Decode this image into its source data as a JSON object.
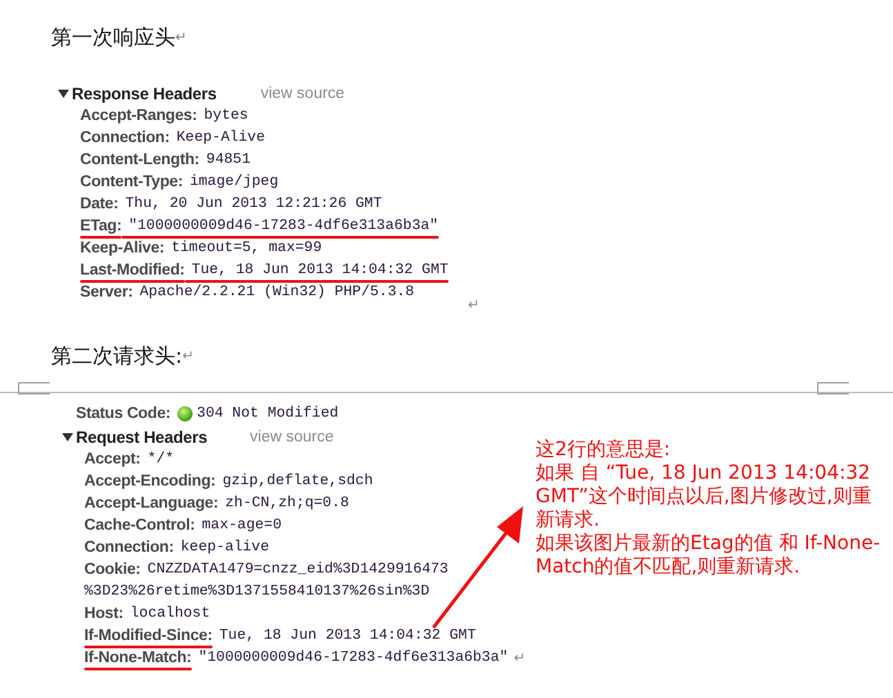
{
  "sections": [
    {
      "heading": "第一次响应头",
      "heading_mark": "↵",
      "panel": {
        "title": "Response Headers",
        "expanded": true,
        "link": "view source",
        "end_mark": "↵",
        "headers": [
          {
            "name": "Accept-Ranges:",
            "value": "bytes",
            "name_underlined": false,
            "value_underlined": false
          },
          {
            "name": "Connection:",
            "value": "Keep-Alive",
            "name_underlined": false,
            "value_underlined": false
          },
          {
            "name": "Content-Length:",
            "value": "94851",
            "name_underlined": false,
            "value_underlined": false
          },
          {
            "name": "Content-Type:",
            "value": "image/jpeg",
            "name_underlined": false,
            "value_underlined": false
          },
          {
            "name": "Date:",
            "value": "Thu, 20 Jun 2013 12:21:26 GMT",
            "name_underlined": false,
            "value_underlined": false
          },
          {
            "name": "ETag:",
            "value": "\"1000000009d46-17283-4df6e313a6b3a\"",
            "name_underlined": true,
            "value_underlined": true
          },
          {
            "name": "Keep-Alive:",
            "value": "timeout=5, max=99",
            "name_underlined": false,
            "value_underlined": false
          },
          {
            "name": "Last-Modified:",
            "value": "Tue, 18 Jun 2013 14:04:32 GMT",
            "name_underlined": true,
            "value_underlined": true
          },
          {
            "name": "Server:",
            "value": "Apache/2.2.21 (Win32) PHP/5.3.8",
            "name_underlined": false,
            "value_underlined": false
          }
        ]
      }
    },
    {
      "heading": "第二次请求头:",
      "heading_mark": "↵",
      "page_break": true,
      "status": {
        "label": "Status Code:",
        "value": "304 Not Modified"
      },
      "panel": {
        "title": "Request Headers",
        "expanded": true,
        "link": "view source",
        "headers": [
          {
            "name": "Accept:",
            "value": "*/*",
            "name_underlined": false,
            "value_underlined": false
          },
          {
            "name": "Accept-Encoding:",
            "value": "gzip,deflate,sdch",
            "name_underlined": false,
            "value_underlined": false
          },
          {
            "name": "Accept-Language:",
            "value": "zh-CN,zh;q=0.8",
            "name_underlined": false,
            "value_underlined": false
          },
          {
            "name": "Cache-Control:",
            "value": "max-age=0",
            "name_underlined": false,
            "value_underlined": false
          },
          {
            "name": "Connection:",
            "value": "keep-alive",
            "name_underlined": false,
            "value_underlined": false
          },
          {
            "name": "Cookie:",
            "value": "CNZZDATA1479=cnzz_eid%3D1429916473",
            "continuation": "%3D23%26retime%3D1371558410137%26sin%3D",
            "name_underlined": false,
            "value_underlined": false
          },
          {
            "name": "Host:",
            "value": "localhost",
            "name_underlined": false,
            "value_underlined": false
          },
          {
            "name": "If-Modified-Since:",
            "value": "Tue, 18 Jun 2013 14:04:32 GMT",
            "name_underlined": true,
            "value_underlined": false
          },
          {
            "name": "If-None-Match:",
            "value": "\"1000000009d46-17283-4df6e313a6b3a\"",
            "name_underlined": true,
            "value_underlined": false,
            "mark": "↵"
          }
        ]
      }
    }
  ],
  "annotation": {
    "paragraphs": [
      "这2行的意思是:",
      "如果 自 “Tue, 18 Jun 2013 14:04:32 GMT”这个时间点以后,图片修改过,则重新请求.",
      "如果该图片最新的Etag的值 和 If-None-Match的值不匹配,则重新请求."
    ]
  }
}
